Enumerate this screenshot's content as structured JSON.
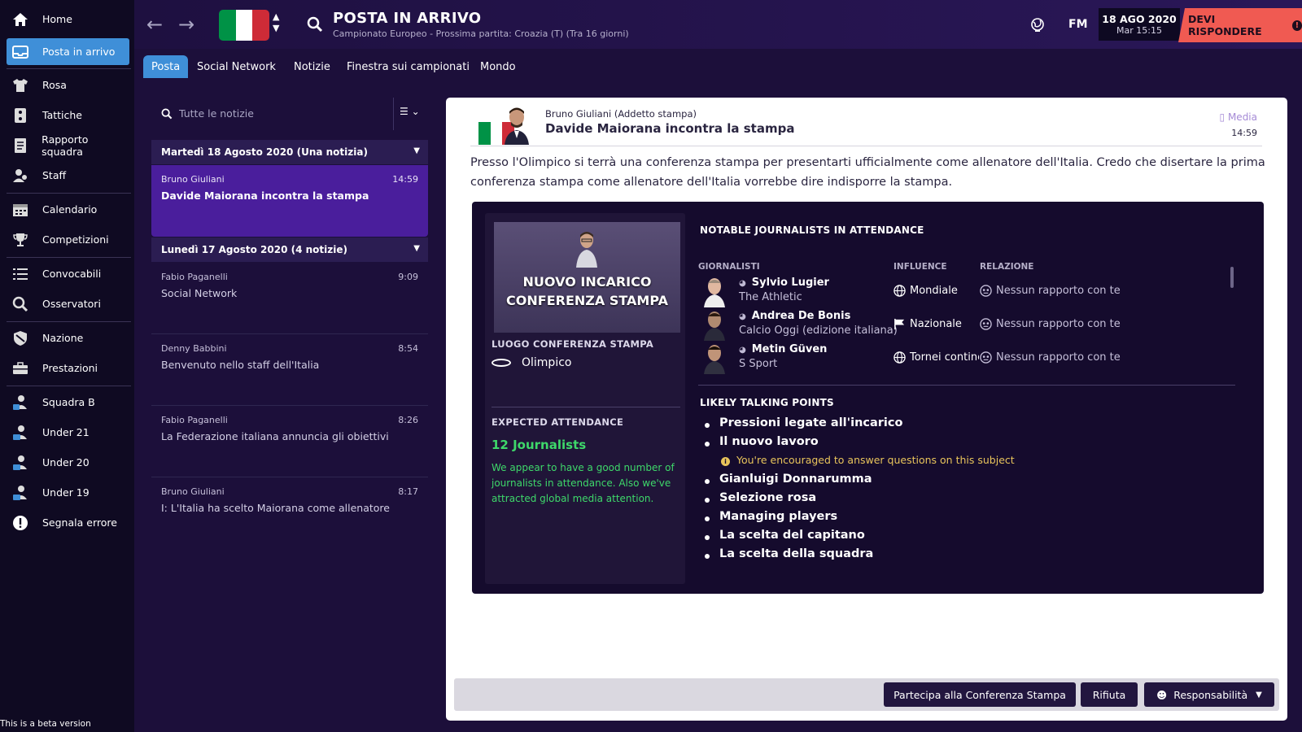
{
  "sidebar": {
    "items": [
      {
        "label": "Home",
        "icon": "home-icon"
      },
      {
        "label": "Posta in arrivo",
        "icon": "inbox-icon"
      },
      {
        "label": "Rosa",
        "icon": "shirt-icon"
      },
      {
        "label": "Tattiche",
        "icon": "tactics-icon"
      },
      {
        "label": "Rapporto squadra",
        "icon": "report-icon"
      },
      {
        "label": "Staff",
        "icon": "staff-icon"
      },
      {
        "label": "Calendario",
        "icon": "calendar-icon"
      },
      {
        "label": "Competizioni",
        "icon": "trophy-icon"
      },
      {
        "label": "Convocabili",
        "icon": "list-icon"
      },
      {
        "label": "Osservatori",
        "icon": "search-icon"
      },
      {
        "label": "Nazione",
        "icon": "shield-icon"
      },
      {
        "label": "Prestazioni",
        "icon": "briefcase-icon"
      },
      {
        "label": "Squadra B",
        "icon": "team-icon"
      },
      {
        "label": "Under 21",
        "icon": "team-icon"
      },
      {
        "label": "Under 20",
        "icon": "team-icon"
      },
      {
        "label": "Under 19",
        "icon": "team-icon"
      },
      {
        "label": "Segnala errore",
        "icon": "alert-icon"
      }
    ],
    "beta_text": "This is a beta version"
  },
  "header": {
    "title": "POSTA IN ARRIVO",
    "subtitle": "Campionato Europeo - Prossima partita: Croazia (T) (Tra 16 giorni)",
    "fm_label": "FM",
    "date": "18 AGO 2020",
    "time": "Mar 15:15",
    "respond_label": "DEVI RISPONDERE",
    "flag_colors": [
      "#009246",
      "#ffffff",
      "#ce2b37"
    ]
  },
  "tabs": [
    {
      "label": "Posta"
    },
    {
      "label": "Social Network"
    },
    {
      "label": "Notizie"
    },
    {
      "label": "Finestra sui campionati"
    },
    {
      "label": "Mondo"
    }
  ],
  "inbox": {
    "search_placeholder": "Tutte le notizie",
    "groups": [
      {
        "label": "Martedì 18 Agosto 2020 (Una notizia)"
      },
      {
        "label": "Lunedì 17 Agosto 2020 (4 notizie)"
      }
    ],
    "messages": [
      {
        "sender": "Bruno Giuliani",
        "time": "14:59",
        "subject": "Davide Maiorana incontra la stampa"
      },
      {
        "sender": "Fabio Paganelli",
        "time": "9:09",
        "subject": "Social Network"
      },
      {
        "sender": "Denny Babbini",
        "time": "8:54",
        "subject": "Benvenuto nello staff dell'Italia"
      },
      {
        "sender": "Fabio Paganelli",
        "time": "8:26",
        "subject": "La Federazione italiana annuncia gli obiettivi"
      },
      {
        "sender": "Bruno Giuliani",
        "time": "8:17",
        "subject": "I: L'Italia ha scelto Maiorana come allenatore"
      }
    ]
  },
  "message": {
    "sender": "Bruno Giuliani  (Addetto stampa)",
    "subject": "Davide Maiorana incontra la stampa",
    "tag": "Media",
    "time": "14:59",
    "body": "Presso l'Olimpico si terrà una conferenza stampa per presentarti ufficialmente come allenatore dell'Italia. Credo che disertare la prima conferenza stampa come allenatore dell'Italia vorrebbe dire indisporre la stampa."
  },
  "conference": {
    "image_text_line1": "NUOVO INCARICO",
    "image_text_line2": "CONFERENZA STAMPA",
    "venue_label": "LUOGO CONFERENZA STAMPA",
    "venue": "Olimpico",
    "attendance_label": "EXPECTED ATTENDANCE",
    "attendance_count": "12 Journalists",
    "attendance_text": "We appear to have a good number of journalists in attendance. Also we've attracted global media attention.",
    "journalists_title": "NOTABLE JOURNALISTS IN ATTENDANCE",
    "col_journalists": "GIORNALISTI",
    "col_influence": "INFLUENCE",
    "col_relation": "RELAZIONE",
    "journalists": [
      {
        "name": "Sylvio Lugier",
        "outlet": "The Athletic",
        "influence": "Mondiale",
        "relation": "Nessun rapporto con te"
      },
      {
        "name": "Andrea De Bonis",
        "outlet": "Calcio Oggi (edizione italiana)",
        "influence": "Nazionale",
        "relation": "Nessun rapporto con te"
      },
      {
        "name": "Metin Güven",
        "outlet": "S Sport",
        "influence": "Tornei continentali",
        "relation": "Nessun rapporto con te"
      }
    ],
    "points_title": "LIKELY TALKING POINTS",
    "points": [
      "Pressioni legate all'incarico",
      "Il nuovo lavoro",
      "Gianluigi Donnarumma",
      "Selezione rosa",
      "Managing players",
      "La scelta del capitano",
      "La scelta della squadra"
    ],
    "point_note": "You're encouraged to answer questions on this subject"
  },
  "actions": {
    "attend": "Partecipa alla Conferenza Stampa",
    "refuse": "Rifiuta",
    "responsibility": "Responsabilità"
  },
  "colors": {
    "accent": "#3f8fd8",
    "selected": "#4a1e9c",
    "alert": "#f05a52",
    "positive": "#3ed86a",
    "note": "#e8c45b"
  }
}
